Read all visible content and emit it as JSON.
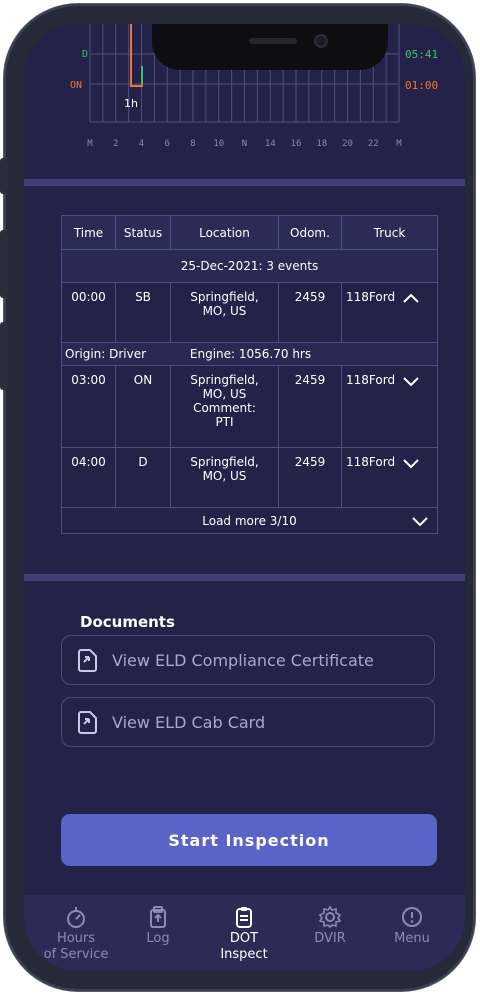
{
  "graph": {
    "row_labels": {
      "driving": "D",
      "on_duty": "ON"
    },
    "row_totals": {
      "driving": "05:41",
      "on_duty": "01:00"
    },
    "hour_marker": "1h",
    "axis_ticks": [
      "M",
      "2",
      "4",
      "6",
      "8",
      "10",
      "N",
      "14",
      "16",
      "18",
      "20",
      "22",
      "M"
    ],
    "colors": {
      "driving": "#3ec16a",
      "on_duty": "#ef7436"
    }
  },
  "table": {
    "headers": {
      "time": "Time",
      "status": "Status",
      "location": "Location",
      "odom": "Odom.",
      "truck": "Truck"
    },
    "date_row": "25-Dec-2021: 3 events",
    "events": [
      {
        "time": "00:00",
        "status": "SB",
        "location_line1": "Springfield,",
        "location_line2": "MO, US",
        "comment_label": "",
        "comment": "",
        "odom": "2459",
        "truck": "118Ford",
        "expanded": true
      },
      {
        "time": "03:00",
        "status": "ON",
        "location_line1": "Springfield,",
        "location_line2": "MO, US",
        "comment_label": "Comment:",
        "comment": "PTI",
        "odom": "2459",
        "truck": "118Ford",
        "expanded": false
      },
      {
        "time": "04:00",
        "status": "D",
        "location_line1": "Springfield,",
        "location_line2": "MO, US",
        "comment_label": "",
        "comment": "",
        "odom": "2459",
        "truck": "118Ford",
        "expanded": false
      }
    ],
    "expanded_meta": {
      "origin": "Origin: Driver",
      "engine": "Engine: 1056.70 hrs"
    },
    "load_more": "Load more 3/10"
  },
  "documents": {
    "title": "Documents",
    "items": [
      {
        "label": "View ELD Compliance Certificate",
        "icon": "document-icon"
      },
      {
        "label": "View ELD Cab Card",
        "icon": "document-icon"
      }
    ]
  },
  "start_inspection": "Start Inspection",
  "nav": [
    {
      "label_line1": "Hours",
      "label_line2": "of Service",
      "icon": "stopwatch-icon",
      "active": false
    },
    {
      "label_line1": "Log",
      "label_line2": "",
      "icon": "log-icon",
      "active": false
    },
    {
      "label_line1": "DOT",
      "label_line2": "Inspect",
      "icon": "clipboard-icon",
      "active": true
    },
    {
      "label_line1": "DVIR",
      "label_line2": "",
      "icon": "gear-icon",
      "active": false
    },
    {
      "label_line1": "Menu",
      "label_line2": "",
      "icon": "info-icon",
      "active": false
    }
  ]
}
